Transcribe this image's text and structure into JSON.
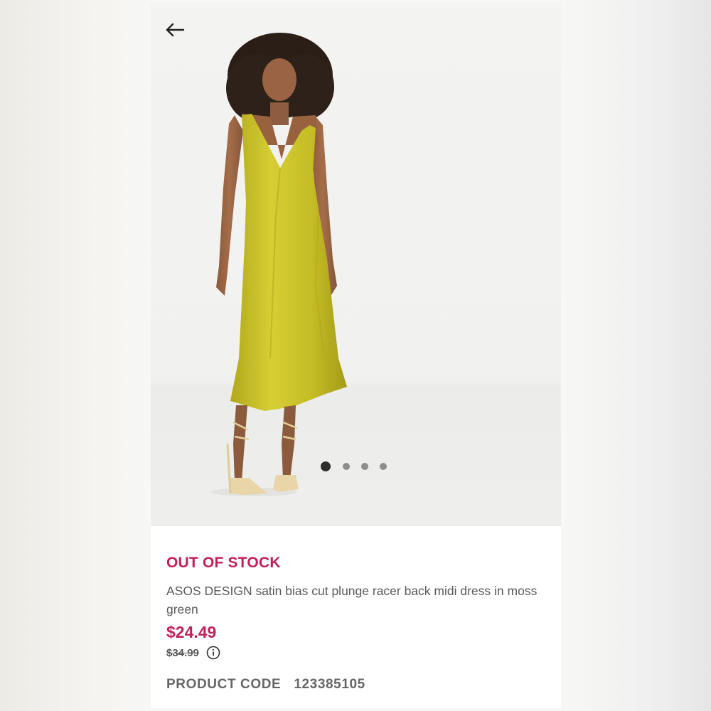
{
  "navigation": {
    "back_icon": "arrow-left-icon"
  },
  "gallery": {
    "image_description": "Model wearing moss green satin midi dress",
    "slide_count": 4,
    "active_slide": 1
  },
  "product": {
    "stock_status": "OUT OF STOCK",
    "title": "ASOS DESIGN satin bias cut plunge racer back midi dress in moss green",
    "price": "$24.49",
    "was_price": "$34.99",
    "price_info_icon": "info-icon",
    "code_label": "PRODUCT CODE",
    "code_value": "123385105"
  },
  "colors": {
    "accent": "#c0215a",
    "text_gray": "#595959",
    "dress": "#c9c227"
  }
}
